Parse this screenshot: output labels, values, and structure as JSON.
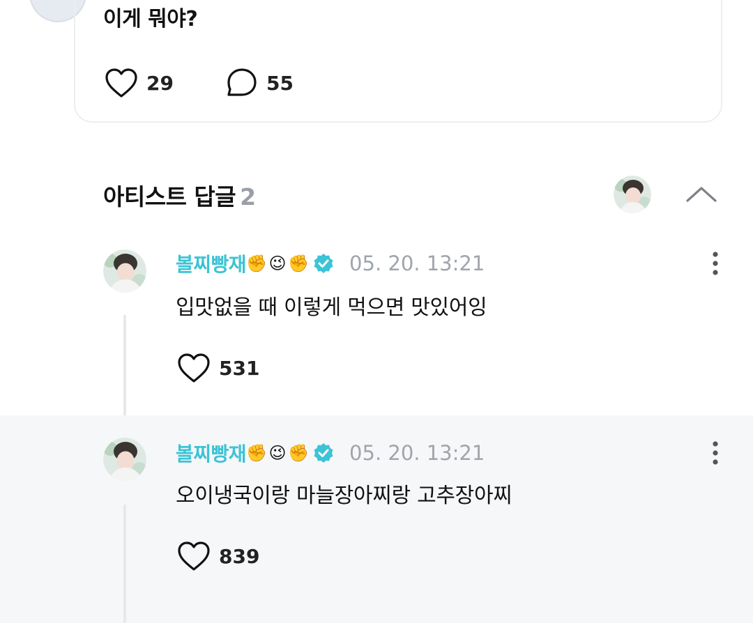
{
  "post": {
    "text": "이게 뭐야?",
    "likes": "29",
    "comments": "55"
  },
  "artist_replies": {
    "title": "아티스트 답글",
    "count": "2",
    "replies": [
      {
        "author": "볼찌빵재",
        "emojis": [
          "✊",
          "😉",
          "✊"
        ],
        "timestamp": "05. 20. 13:21",
        "text": "입맛없을 때 이렇게 먹으면 맛있어잉",
        "likes": "531"
      },
      {
        "author": "볼찌빵재",
        "emojis": [
          "✊",
          "😉",
          "✊"
        ],
        "timestamp": "05. 20. 13:21",
        "text": "오이냉국이랑 마늘장아찌랑 고추장아찌",
        "likes": "839"
      }
    ]
  },
  "colors": {
    "author_accent": "#3cc3d6",
    "verified_badge": "#3cc3d6",
    "muted_text": "#a0a4ab",
    "highlight_bg": "#f6f7f9"
  },
  "icons": [
    "heart-icon",
    "comment-icon",
    "chevron-up-icon",
    "verified-icon",
    "more-vertical-icon"
  ]
}
